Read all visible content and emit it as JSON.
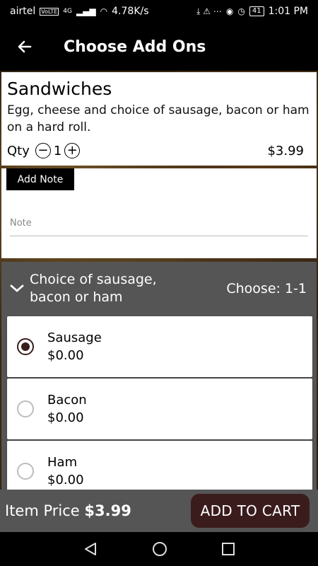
{
  "status_bar": {
    "carrier": "airtel",
    "network_badges": [
      "VoLTE",
      "4G"
    ],
    "speed": "4.78K/s",
    "battery": "41",
    "time": "1:01 PM"
  },
  "app_bar": {
    "title": "Choose Add Ons"
  },
  "item": {
    "name": "Sandwiches",
    "description": "Egg, cheese and choice of sausage, bacon or ham on a  hard roll.",
    "qty_label": "Qty",
    "qty_value": "1",
    "price": "$3.99"
  },
  "note": {
    "button_label": "Add Note",
    "placeholder": "Note"
  },
  "choice_group": {
    "title": "Choice of sausage, bacon or ham",
    "rule": "Choose: 1-1",
    "options": [
      {
        "name": "Sausage",
        "price": "$0.00",
        "selected": true
      },
      {
        "name": "Bacon",
        "price": "$0.00",
        "selected": false
      },
      {
        "name": "Ham",
        "price": "$0.00",
        "selected": false
      }
    ]
  },
  "footer": {
    "item_price_label": "Item Price",
    "item_price_value": "$3.99",
    "add_to_cart_label": "ADD TO CART"
  },
  "colors": {
    "accent": "#3a1c1c",
    "panel": "#555555",
    "bar": "#000000"
  },
  "icons": [
    "back-arrow-icon",
    "minus-circle-icon",
    "plus-circle-icon",
    "chevron-down-icon",
    "nav-back-icon",
    "nav-home-icon",
    "nav-recents-icon"
  ]
}
